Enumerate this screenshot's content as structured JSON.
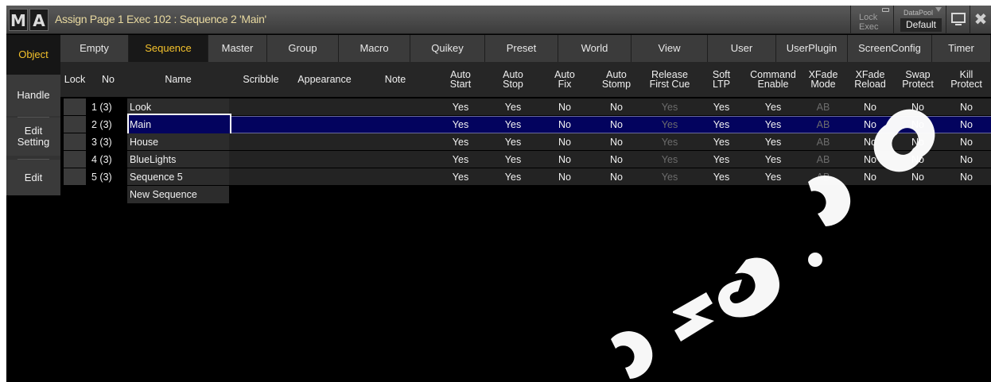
{
  "titlebar": {
    "logo_m": "M",
    "logo_a": "A",
    "title": "Assign Page 1 Exec 102 : Sequence 2 'Main'",
    "lock_exec_line1": "Lock",
    "lock_exec_line2": "Exec",
    "datapool_label": "DataPool",
    "datapool_value": "Default",
    "close_glyph": "✖"
  },
  "sidebar": {
    "items": [
      {
        "label": "Object",
        "active": true
      },
      {
        "label": "Handle"
      },
      {
        "label_line1": "Edit",
        "label_line2": "Setting"
      },
      {
        "label": "Edit"
      }
    ]
  },
  "tabs": [
    "Empty",
    "Sequence",
    "Master",
    "Group",
    "Macro",
    "Quikey",
    "Preset",
    "World",
    "View",
    "User",
    "UserPlugin",
    "ScreenConfig",
    "Timer"
  ],
  "active_tab": "Sequence",
  "columns": [
    {
      "key": "lock",
      "label1": "Lock",
      "label2": ""
    },
    {
      "key": "no",
      "label1": "No",
      "label2": ""
    },
    {
      "key": "name",
      "label1": "Name",
      "label2": ""
    },
    {
      "key": "scribble",
      "label1": "Scribble",
      "label2": ""
    },
    {
      "key": "appearance",
      "label1": "Appearance",
      "label2": ""
    },
    {
      "key": "note",
      "label1": "Note",
      "label2": ""
    },
    {
      "key": "auto_start",
      "label1": "Auto",
      "label2": "Start"
    },
    {
      "key": "auto_stop",
      "label1": "Auto",
      "label2": "Stop"
    },
    {
      "key": "auto_fix",
      "label1": "Auto",
      "label2": "Fix"
    },
    {
      "key": "auto_stomp",
      "label1": "Auto",
      "label2": "Stomp"
    },
    {
      "key": "release_first_cue",
      "label1": "Release",
      "label2": "First Cue"
    },
    {
      "key": "soft_ltp",
      "label1": "Soft",
      "label2": "LTP"
    },
    {
      "key": "command_enable",
      "label1": "Command",
      "label2": "Enable"
    },
    {
      "key": "xfade_mode",
      "label1": "XFade",
      "label2": "Mode"
    },
    {
      "key": "xfade_reload",
      "label1": "XFade",
      "label2": "Reload"
    },
    {
      "key": "swap_protect",
      "label1": "Swap",
      "label2": "Protect"
    },
    {
      "key": "kill_protect",
      "label1": "Kill",
      "label2": "Protect"
    }
  ],
  "rows": [
    {
      "no": "1 (3)",
      "name": "Look",
      "auto_start": "Yes",
      "auto_stop": "Yes",
      "auto_fix": "No",
      "auto_stomp": "No",
      "release_first_cue": "Yes",
      "soft_ltp": "Yes",
      "command_enable": "Yes",
      "xfade_mode": "AB",
      "xfade_reload": "No",
      "swap_protect": "No",
      "kill_protect": "No",
      "selected": false
    },
    {
      "no": "2 (3)",
      "name": "Main",
      "auto_start": "Yes",
      "auto_stop": "Yes",
      "auto_fix": "No",
      "auto_stomp": "No",
      "release_first_cue": "Yes",
      "soft_ltp": "Yes",
      "command_enable": "Yes",
      "xfade_mode": "AB",
      "xfade_reload": "No",
      "swap_protect": "No",
      "kill_protect": "No",
      "selected": true
    },
    {
      "no": "3 (3)",
      "name": "House",
      "auto_start": "Yes",
      "auto_stop": "Yes",
      "auto_fix": "No",
      "auto_stomp": "No",
      "release_first_cue": "Yes",
      "soft_ltp": "Yes",
      "command_enable": "Yes",
      "xfade_mode": "AB",
      "xfade_reload": "No",
      "swap_protect": "No",
      "kill_protect": "No",
      "selected": false
    },
    {
      "no": "4 (3)",
      "name": "BlueLights",
      "auto_start": "Yes",
      "auto_stop": "Yes",
      "auto_fix": "No",
      "auto_stomp": "No",
      "release_first_cue": "Yes",
      "soft_ltp": "Yes",
      "command_enable": "Yes",
      "xfade_mode": "AB",
      "xfade_reload": "No",
      "swap_protect": "No",
      "kill_protect": "No",
      "selected": false
    },
    {
      "no": "5 (3)",
      "name": "Sequence 5",
      "auto_start": "Yes",
      "auto_stop": "Yes",
      "auto_fix": "No",
      "auto_stomp": "No",
      "release_first_cue": "Yes",
      "soft_ltp": "Yes",
      "command_enable": "Yes",
      "xfade_mode": "AB",
      "xfade_reload": "No",
      "swap_protect": "No",
      "kill_protect": "No",
      "selected": false
    }
  ],
  "new_row_label": "New Sequence",
  "colors": {
    "accent": "#f3c12b",
    "selection": "#03035e",
    "title_text": "#e8d9a0"
  }
}
